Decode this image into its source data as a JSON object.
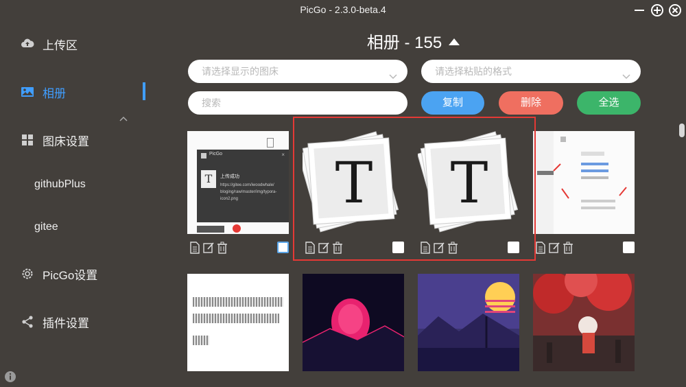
{
  "window": {
    "title": "PicGo - 2.3.0-beta.4"
  },
  "sidebar": {
    "items": [
      {
        "label": "上传区",
        "icon": "cloud-upload-icon"
      },
      {
        "label": "相册",
        "icon": "image-icon"
      },
      {
        "label": "图床设置",
        "icon": "grid-icon"
      },
      {
        "label": "PicGo设置",
        "icon": "gear-icon"
      },
      {
        "label": "插件设置",
        "icon": "share-icon"
      }
    ],
    "sub_items": [
      "githubPlus",
      "gitee"
    ],
    "active_color": "#409eff"
  },
  "gallery": {
    "title": "相册 - 155",
    "picbed_select": {
      "placeholder": "请选择显示的图床"
    },
    "format_select": {
      "placeholder": "请选择粘贴的格式"
    },
    "search": {
      "placeholder": "搜索"
    },
    "buttons": {
      "copy": "复制",
      "delete": "删除",
      "select_all": "全选"
    },
    "button_colors": {
      "copy": "#4ba3f2",
      "delete": "#ef6f60",
      "select_all": "#3cb56a"
    },
    "thumb1": {
      "app": "PicGo",
      "heading": "上传成功",
      "url_lines": [
        "https://gitee.com/iwoodwhale/",
        "bloging/raw/master/img/typora-",
        "icon2.png"
      ],
      "letter": "T"
    },
    "typora_letter": "T",
    "selection_color": "#e53935"
  }
}
